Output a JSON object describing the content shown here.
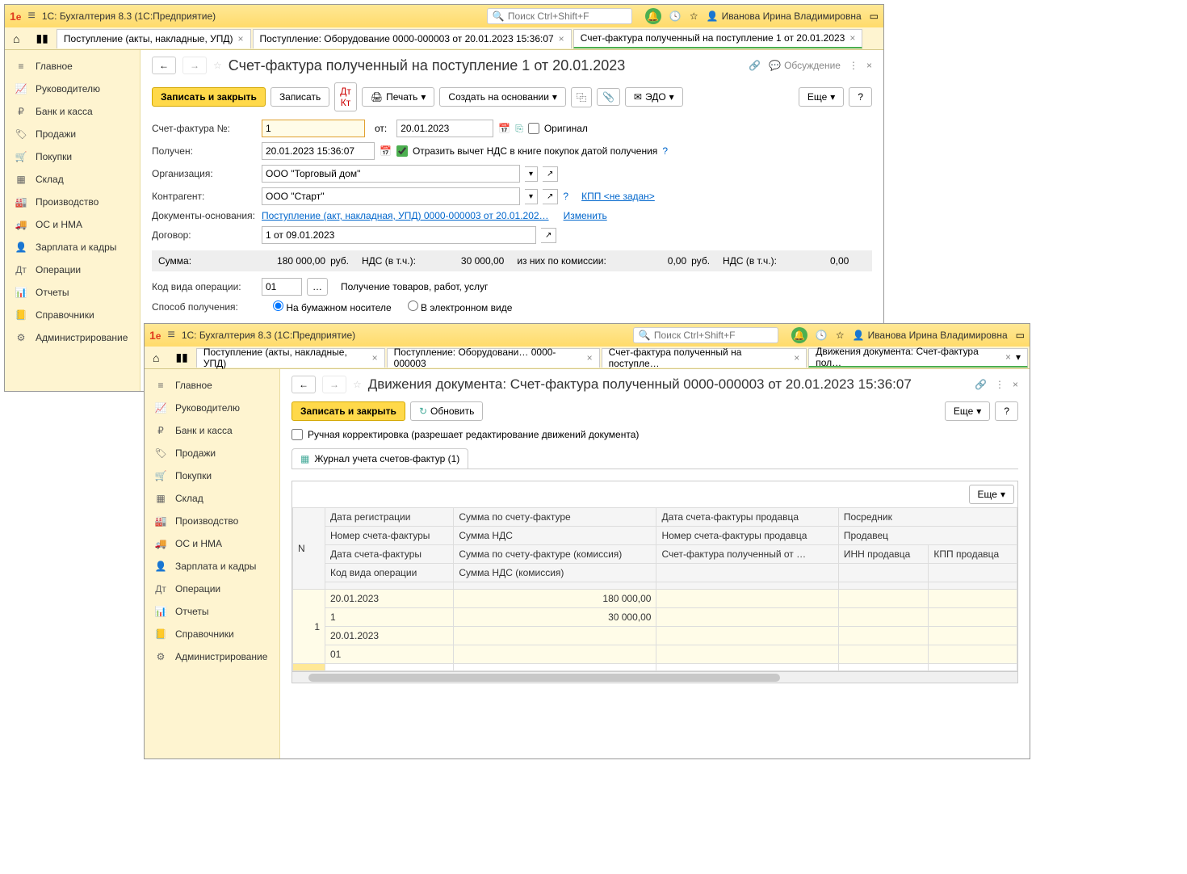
{
  "app": {
    "title": "1С: Бухгалтерия 8.3  (1С:Предприятие)",
    "search_ph": "Поиск Ctrl+Shift+F",
    "user": "Иванова Ирина Владимировна"
  },
  "sidebar": [
    "Главное",
    "Руководителю",
    "Банк и касса",
    "Продажи",
    "Покупки",
    "Склад",
    "Производство",
    "ОС и НМА",
    "Зарплата и кадры",
    "Операции",
    "Отчеты",
    "Справочники",
    "Администрирование"
  ],
  "w1": {
    "tabs": [
      "Поступление (акты, накладные, УПД)",
      "Поступление: Оборудование 0000-000003 от 20.01.2023 15:36:07",
      "Счет-фактура полученный на поступление 1 от 20.01.2023"
    ],
    "doc_title": "Счет-фактура полученный на поступление 1 от 20.01.2023",
    "discuss": "Обсуждение",
    "btns": {
      "save": "Записать и закрыть",
      "write": "Записать",
      "print": "Печать",
      "create": "Создать на основании",
      "edo": "ЭДО",
      "more": "Еще",
      "help": "?"
    },
    "labels": {
      "num": "Счет-фактура №:",
      "from": "от:",
      "orig": "Оригинал",
      "received": "Получен:",
      "reflect": "Отразить вычет НДС в книге покупок датой получения",
      "org": "Организация:",
      "contr": "Контрагент:",
      "kpp": "КПП <не задан>",
      "docs": "Документы-основания:",
      "change": "Изменить",
      "contract": "Договор:",
      "sum": "Сумма:",
      "rub": "руб.",
      "vat": "НДС (в т.ч.):",
      "commission": "из них по комиссии:",
      "opcode": "Код вида операции:",
      "opdesc": "Получение товаров, работ, услуг",
      "method": "Способ получения:",
      "paper": "На бумажном носителе",
      "electronic": "В электронном виде"
    },
    "vals": {
      "num": "1",
      "date": "20.01.2023",
      "received": "20.01.2023 15:36:07",
      "org": "ООО \"Торговый дом\"",
      "contr": "ООО \"Старт\"",
      "docbase": "Поступление (акт, накладная, УПД) 0000-000003 от 20.01.202…",
      "contract": "1 от 09.01.2023",
      "sum": "180 000,00",
      "vat": "30 000,00",
      "comm": "0,00",
      "vat2": "0,00",
      "opcode": "01"
    }
  },
  "w2": {
    "tabs": [
      "Поступление (акты, накладные, УПД)",
      "Поступление: Оборудовани… 0000-000003",
      "Счет-фактура полученный на поступле…",
      "Движения документа: Счет-фактура пол…"
    ],
    "doc_title": "Движения документа: Счет-фактура полученный 0000-000003 от 20.01.2023 15:36:07",
    "btns": {
      "save": "Записать и закрыть",
      "refresh": "Обновить",
      "more": "Еще",
      "help": "?"
    },
    "manual": "Ручная корректировка (разрешает редактирование движений документа)",
    "tab_journal": "Журнал учета счетов-фактур (1)",
    "headers": {
      "n": "N",
      "regdate": "Дата регистрации",
      "invnum": "Номер счета-фактуры",
      "invdate": "Дата счета-фактуры",
      "opcode": "Код вида операции",
      "sum": "Сумма по счету-фактуре",
      "vat": "Сумма НДС",
      "sumcomm": "Сумма по счету-фактуре (комиссия)",
      "vatcomm": "Сумма НДС (комиссия)",
      "seller_date": "Дата счета-фактуры продавца",
      "seller_num": "Номер счета-фактуры продавца",
      "inv_received": "Счет-фактура полученный от …",
      "middleman": "Посредник",
      "seller": "Продавец",
      "inn": "ИНН продавца",
      "kpp": "КПП продавца"
    },
    "row": {
      "n": "1",
      "regdate": "20.01.2023",
      "invnum": "1",
      "invdate": "20.01.2023",
      "opcode": "01",
      "sum": "180 000,00",
      "vat": "30 000,00"
    }
  }
}
